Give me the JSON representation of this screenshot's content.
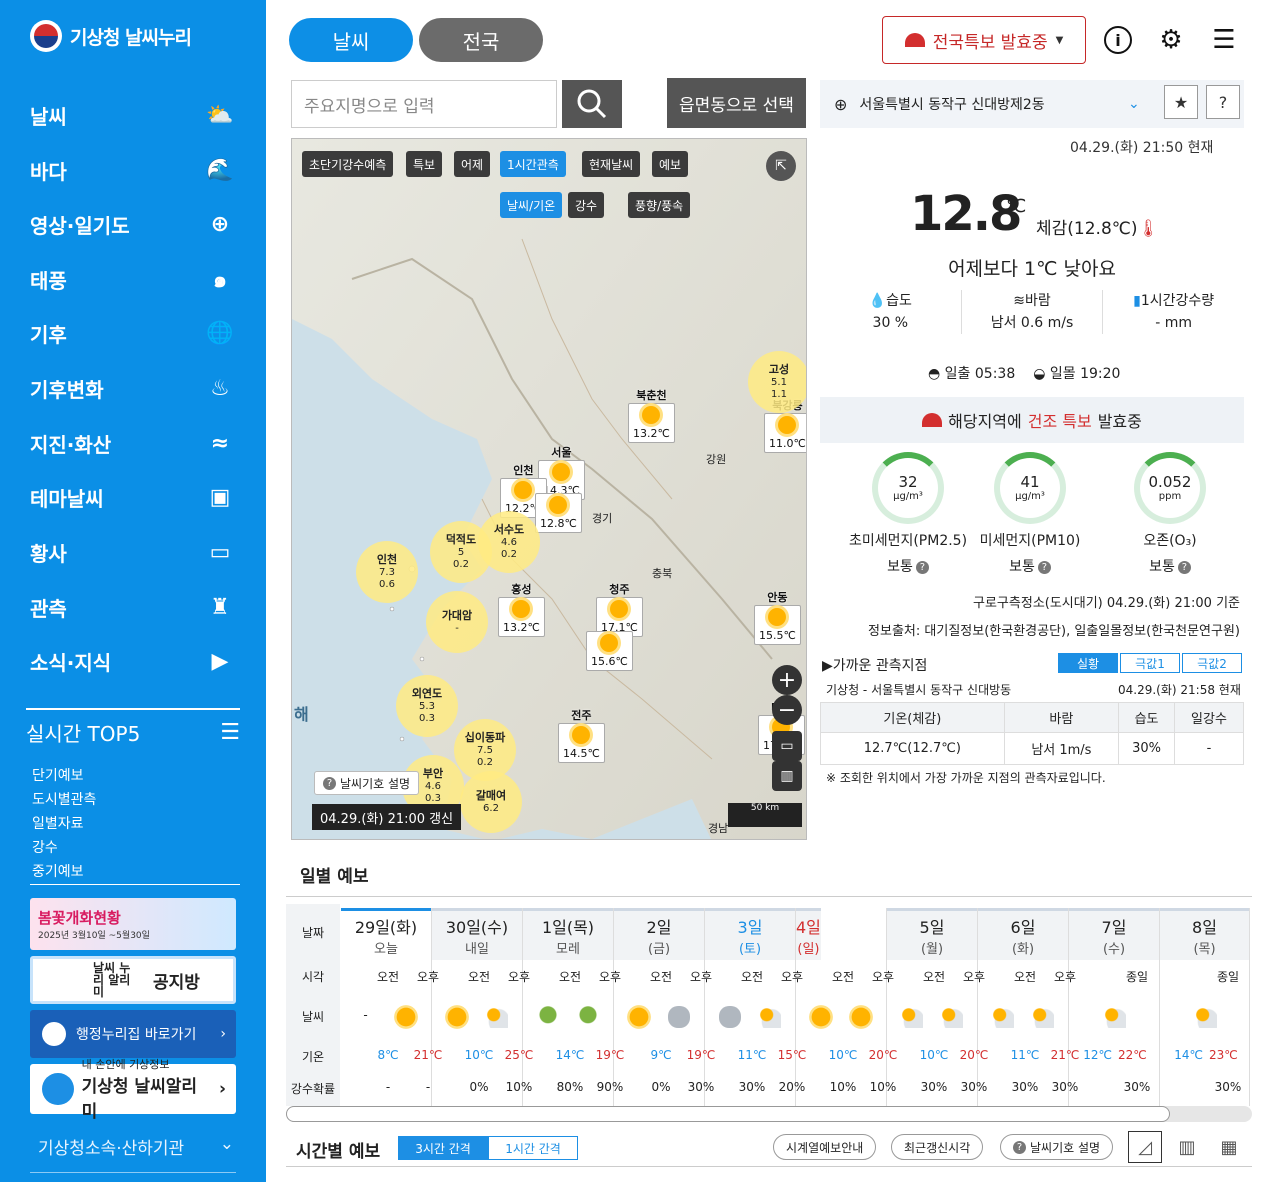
{
  "sidebar": {
    "logo": "기상청 날씨누리",
    "menu": [
      {
        "label": "날씨",
        "icon": "weather-icon"
      },
      {
        "label": "바다",
        "icon": "wave-icon"
      },
      {
        "label": "영상·일기도",
        "icon": "radar-icon"
      },
      {
        "label": "태풍",
        "icon": "typhoon-icon"
      },
      {
        "label": "기후",
        "icon": "globe-icon"
      },
      {
        "label": "기후변화",
        "icon": "heat-icon"
      },
      {
        "label": "지진·화산",
        "icon": "earthquake-icon"
      },
      {
        "label": "테마날씨",
        "icon": "suitcase-icon"
      },
      {
        "label": "황사",
        "icon": "dust-icon"
      },
      {
        "label": "관측",
        "icon": "tower-icon"
      },
      {
        "label": "소식·지식",
        "icon": "video-icon"
      }
    ],
    "top5_title": "실시간 TOP5",
    "top5": [
      "단기예보",
      "도시별관측",
      "일별자료",
      "강수",
      "중기예보"
    ],
    "banner1_title": "봄꽃개화현황",
    "banner1_sub": "2025년 3월10일 ~5월30일",
    "banner2_small": "날씨 누리 알리미",
    "banner2_title": "공지방",
    "banner3": "행정누리집 바로가기",
    "banner4_small": "내 손안에 기상정보",
    "banner4": "기상청 날씨알리미",
    "footer_link": "기상청소속·산하기관"
  },
  "header": {
    "tab_weather": "날씨",
    "tab_national": "전국",
    "alert_button": "전국특보 발효중",
    "search_placeholder": "주요지명으로 입력",
    "dong_button": "읍면동으로 선택",
    "location": "서울특별시 동작구 신대방제2동"
  },
  "map": {
    "tabs": [
      "초단기강수예측",
      "특보",
      "어제",
      "1시간관측",
      "현재날씨",
      "예보"
    ],
    "active_tab": "1시간관측",
    "subtabs": [
      "날씨/기온",
      "강수",
      "풍향/풍속"
    ],
    "note": "날씨기호 설명",
    "time": "04.29.(화) 21:00 갱신",
    "scale": "50 km",
    "regions": [
      "강원",
      "경기",
      "충북",
      "경남",
      "해"
    ],
    "stations": [
      {
        "name": "북춘천",
        "temp": "13.2℃"
      },
      {
        "name": "서울",
        "temp": "14.3℃"
      },
      {
        "name": "인천",
        "temp": "12.2℃"
      },
      {
        "name": "",
        "temp": "12.8℃"
      },
      {
        "name": "홍성",
        "temp": "13.2℃"
      },
      {
        "name": "청주",
        "temp": "17.1℃"
      },
      {
        "name": "",
        "temp": "15.6℃"
      },
      {
        "name": "전주",
        "temp": "14.5℃"
      },
      {
        "name": "안동",
        "temp": "15.5℃"
      },
      {
        "name": "북강릉",
        "temp": "11.0℃"
      },
      {
        "name": "대구",
        "temp": "17.4℃"
      }
    ],
    "winds": [
      {
        "name": "고성",
        "speed": "5.1",
        "wave": "1.1"
      },
      {
        "name": "덕적도",
        "speed": "5",
        "wave": "0.2"
      },
      {
        "name": "서수도",
        "speed": "4.6",
        "wave": "0.2"
      },
      {
        "name": "인천",
        "speed": "7.3",
        "wave": "0.6"
      },
      {
        "name": "가대암",
        "speed": "-",
        "wave": ""
      },
      {
        "name": "외연도",
        "speed": "5.3",
        "wave": "0.3"
      },
      {
        "name": "십이동파",
        "speed": "7.5",
        "wave": "0.2"
      },
      {
        "name": "부안",
        "speed": "4.6",
        "wave": "0.3"
      },
      {
        "name": "갈매여",
        "speed": "6.2",
        "wave": ""
      }
    ]
  },
  "current": {
    "time": "04.29.(화) 21:50 현재",
    "temp": "12.8",
    "unit": "℃",
    "feel": "체감(12.8℃)",
    "compare": "어제보다 1℃ 낮아요",
    "humidity_label": "습도",
    "humidity": "30 %",
    "wind_label": "바람",
    "wind": "남서 0.6 m/s",
    "rain_label": "1시간강수량",
    "rain": "- mm",
    "sunrise": "일출  05:38",
    "sunset": "일몰  19:20"
  },
  "warning": {
    "pre": "해당지역에",
    "highlight": "건조 특보",
    "post": "발효중"
  },
  "air": [
    {
      "value": "32",
      "unit": "μg/m³",
      "name": "초미세먼지(PM2.5)",
      "grade": "보통"
    },
    {
      "value": "41",
      "unit": "μg/m³",
      "name": "미세먼지(PM10)",
      "grade": "보통"
    },
    {
      "value": "0.052",
      "unit": "ppm",
      "name": "오존(O₃)",
      "grade": "보통"
    }
  ],
  "air_source": "구로구측정소(도시대기) 04.29.(화) 21:00 기준",
  "info_source": "정보출처: 대기질정보(한국환경공단), 일출일몰정보(한국천문연구원)",
  "near": {
    "title": "▶가까운 관측지점",
    "tabs": [
      "실황",
      "극값1",
      "극값2"
    ],
    "station": "기상청 - 서울특별시 동작구 신대방동",
    "time": "04.29.(화) 21:58 현재",
    "headers": [
      "기온(체감)",
      "바람",
      "습도",
      "일강수"
    ],
    "row": [
      "12.7℃(12.7℃)",
      "남서 1m/s",
      "30%",
      "-"
    ],
    "note": "※ 조회한 위치에서 가장 가까운 지점의 관측자료입니다."
  },
  "daily": {
    "title": "일별 예보",
    "row_labels": [
      "날짜",
      "시각",
      "날씨",
      "기온",
      "강수확률"
    ],
    "am": "오전",
    "pm": "오후",
    "allday": "종일",
    "days": [
      {
        "date": "29일(화)",
        "sub": "오늘",
        "w": [
          "none",
          "sun"
        ],
        "lo": "8℃",
        "hi": "21℃",
        "p": [
          "-",
          "-"
        ]
      },
      {
        "date": "30일(수)",
        "sub": "내일",
        "w": [
          "sun",
          "pc"
        ],
        "lo": "10℃",
        "hi": "25℃",
        "p": [
          "0%",
          "10%"
        ]
      },
      {
        "date": "1일(목)",
        "sub": "모레",
        "w": [
          "rain",
          "rain"
        ],
        "lo": "14℃",
        "hi": "19℃",
        "p": [
          "80%",
          "90%"
        ]
      },
      {
        "date": "2일",
        "sub": "(금)",
        "w": [
          "sun",
          "cloud"
        ],
        "lo": "9℃",
        "hi": "19℃",
        "p": [
          "0%",
          "30%"
        ]
      },
      {
        "date": "3일",
        "sub": "(토)",
        "w": [
          "cloud",
          "pc"
        ],
        "lo": "11℃",
        "hi": "15℃",
        "p": [
          "30%",
          "20%"
        ]
      },
      {
        "date": "4일",
        "sub": "(일)",
        "w": [
          "sun",
          "sun"
        ],
        "lo": "10℃",
        "hi": "20℃",
        "p": [
          "10%",
          "10%"
        ]
      },
      {
        "date": "5일",
        "sub": "(월)",
        "w": [
          "pc",
          "pc"
        ],
        "lo": "10℃",
        "hi": "20℃",
        "p": [
          "30%",
          "30%"
        ]
      },
      {
        "date": "6일",
        "sub": "(화)",
        "w": [
          "pc",
          "pc"
        ],
        "lo": "11℃",
        "hi": "21℃",
        "p": [
          "30%",
          "30%"
        ]
      },
      {
        "date": "7일",
        "sub": "(수)",
        "w": [
          "pc"
        ],
        "lo": "12℃",
        "hi": "22℃",
        "p": [
          "30%"
        ]
      },
      {
        "date": "8일",
        "sub": "(목)",
        "w": [
          "pc"
        ],
        "lo": "14℃",
        "hi": "23℃",
        "p": [
          "30%"
        ]
      }
    ]
  },
  "hourly": {
    "title": "시간별 예보",
    "tabs": [
      "3시간 간격",
      "1시간 간격"
    ],
    "buttons": [
      "시계열예보안내",
      "최근갱신시각",
      "날씨기호 설명"
    ]
  }
}
